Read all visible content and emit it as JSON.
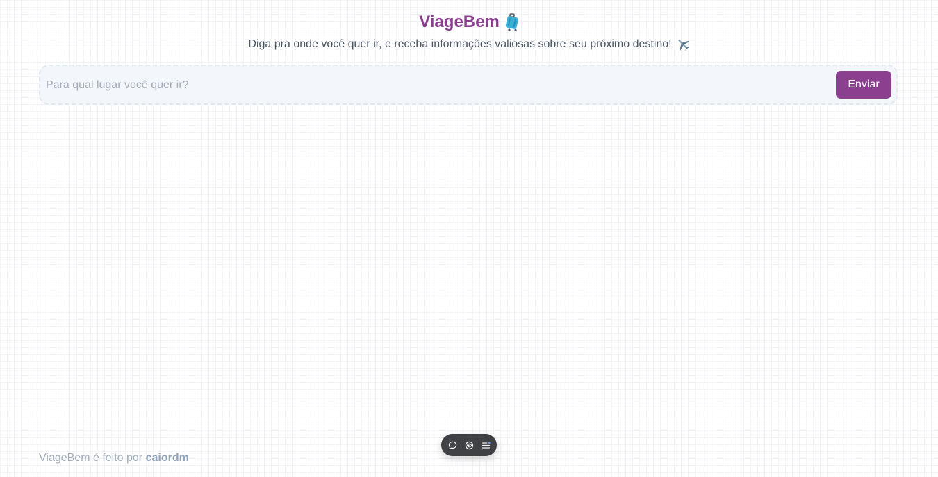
{
  "header": {
    "title": "ViageBem",
    "title_icon": "suitcase-icon",
    "subtitle": "Diga pra onde você quer ir, e receba informações valiosas sobre seu próximo destino!",
    "subtitle_icon": "airplane-icon"
  },
  "search": {
    "value": "",
    "placeholder": "Para qual lugar você quer ir?",
    "submit_label": "Enviar"
  },
  "toolbar": {
    "items": [
      "comment-icon",
      "eye-toggle-icon",
      "menu-list-icon"
    ]
  },
  "footer": {
    "prefix": "ViageBem é feito por",
    "author": "caiordm"
  },
  "colors": {
    "brand": "#8b3f8f",
    "text": "#4b5563",
    "muted": "#a3acb9",
    "input_bg": "#f3f6fa",
    "toolbar_bg": "#3f4145"
  }
}
